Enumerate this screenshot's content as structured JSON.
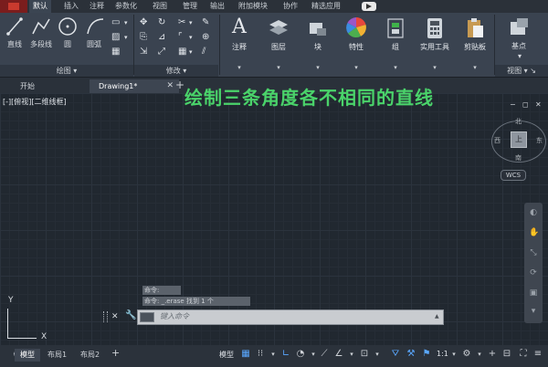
{
  "ribbon_tabs": [
    "默认",
    "插入",
    "注释",
    "参数化",
    "视图",
    "管理",
    "输出",
    "附加模块",
    "协作",
    "精选应用"
  ],
  "active_tab_index": 0,
  "draw_panel": {
    "title": "绘图",
    "tools": [
      "直线",
      "多段线",
      "圆",
      "圆弧"
    ]
  },
  "modify_panel": {
    "title": "修改"
  },
  "big_buttons": [
    "注释",
    "图层",
    "块",
    "特性",
    "组",
    "实用工具",
    "剪贴板",
    "基点"
  ],
  "view_panel": {
    "title": "视图"
  },
  "file_tabs": [
    {
      "label": "开始"
    },
    {
      "label": "Drawing1*"
    }
  ],
  "viewport_label": "[-][俯视][二维线框]",
  "overlay_caption": "绘制三条角度各不相同的直线",
  "viewcube": {
    "top": "北",
    "center": "上",
    "bottom": "南",
    "left": "西",
    "right": "东",
    "wcs": "WCS"
  },
  "ucs": {
    "x": "X",
    "y": "Y"
  },
  "command": {
    "history": [
      "命令:",
      "命令: _.erase 找到 1 个"
    ],
    "placeholder": "键入命令"
  },
  "layout_tabs": [
    "模型",
    "布局1",
    "布局2"
  ],
  "status_bar": {
    "model_label": "模型",
    "scale": "1:1"
  },
  "colors": {
    "caption": "#4ad36a",
    "ribbon_bg": "#3a4350",
    "canvas_bg": "#212830"
  }
}
